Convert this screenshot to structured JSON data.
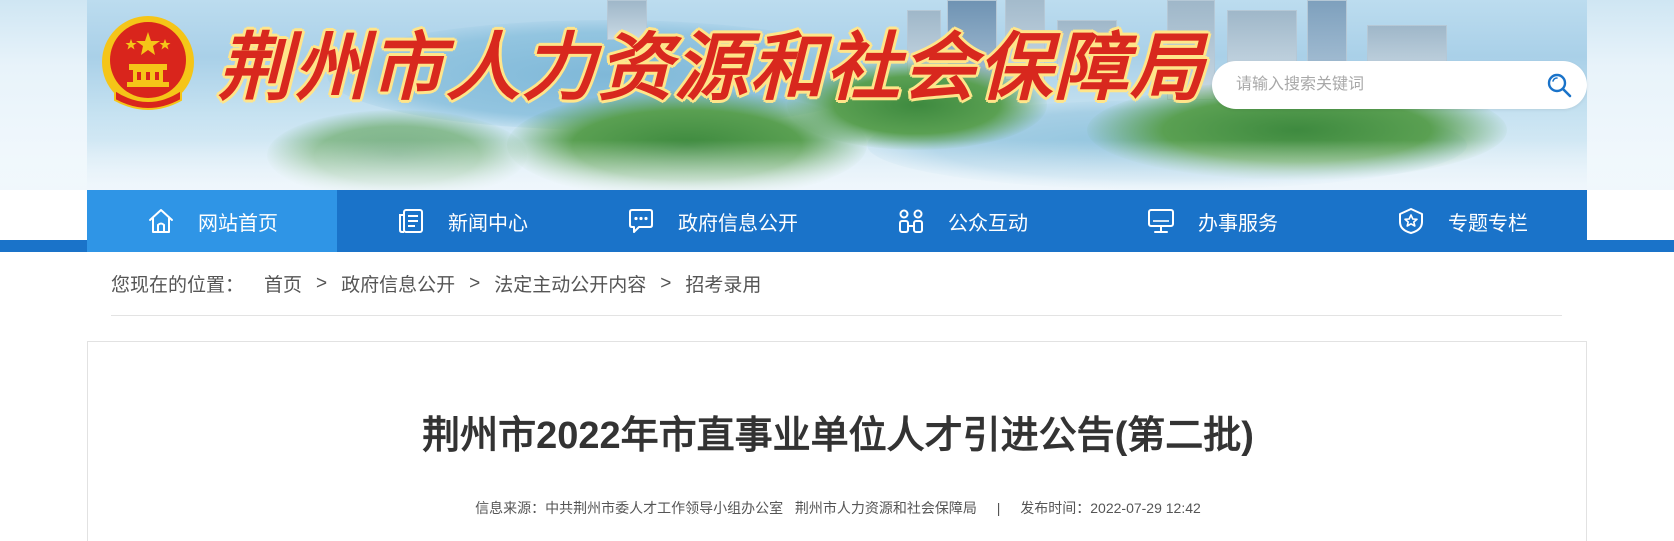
{
  "header": {
    "site_title": "荆州市人力资源和社会保障局",
    "search": {
      "placeholder": "请输入搜索关键词",
      "value": ""
    },
    "colors": {
      "title_red": "#d8281e",
      "title_outline": "#ffe58a",
      "emblem_red": "#d9251c",
      "emblem_gold": "#f5c518"
    }
  },
  "nav": {
    "bg_color": "#1a73c9",
    "active_color": "#2f95e6",
    "items": [
      {
        "label": "网站首页",
        "icon": "home-icon",
        "active": true
      },
      {
        "label": "新闻中心",
        "icon": "news-icon",
        "active": false
      },
      {
        "label": "政府信息公开",
        "icon": "chat-bubble-icon",
        "active": false
      },
      {
        "label": "公众互动",
        "icon": "people-icon",
        "active": false
      },
      {
        "label": "办事服务",
        "icon": "monitor-icon",
        "active": false
      },
      {
        "label": "专题专栏",
        "icon": "badge-star-icon",
        "active": false
      }
    ]
  },
  "breadcrumb": {
    "prefix": "您现在的位置：",
    "separator": ">",
    "items": [
      "首页",
      "政府信息公开",
      "法定主动公开内容",
      "招考录用"
    ]
  },
  "article": {
    "title": "荆州市2022年市直事业单位人才引进公告(第二批)",
    "source_label": "信息来源：",
    "source": "中共荆州市委人才工作领导小组办公室   荆州市人力资源和社会保障局",
    "divider": "|",
    "publish_label": "发布时间：",
    "publish_time": "2022-07-29 12:42"
  }
}
